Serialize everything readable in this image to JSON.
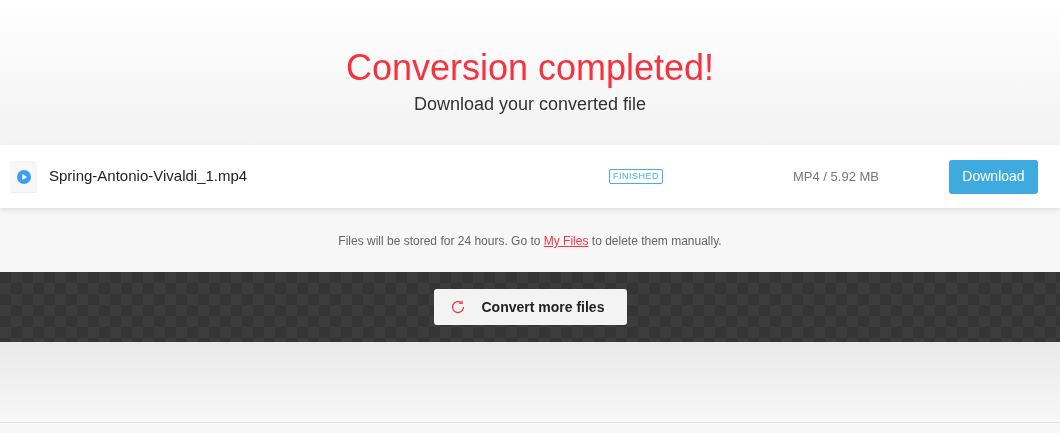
{
  "heading": {
    "title": "Conversion completed!",
    "subtitle": "Download your converted file"
  },
  "files": [
    {
      "name": "Spring-Antonio-Vivaldi_1.mp4",
      "status": "FINISHED",
      "info": "MP4 / 5.92 MB",
      "action": "Download"
    }
  ],
  "note": {
    "before": "Files will be stored for 24 hours. Go to",
    "link": "My Files",
    "after": "to delete them manually."
  },
  "convert_button": "Convert more files"
}
